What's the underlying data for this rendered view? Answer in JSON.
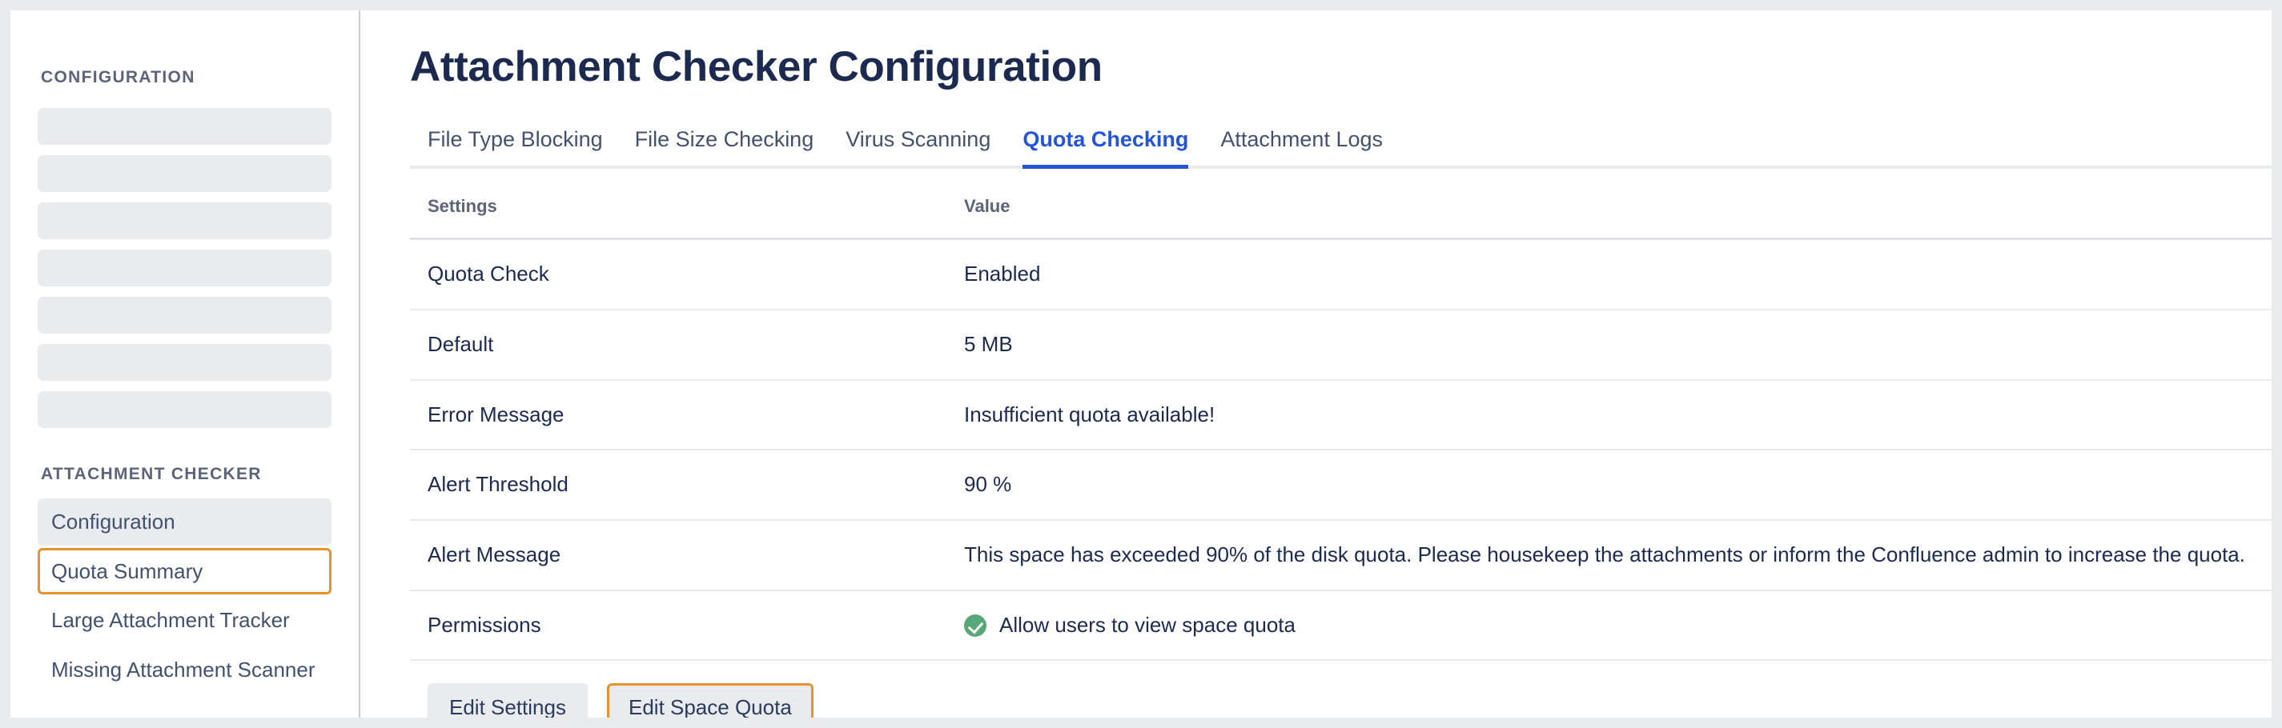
{
  "sidebar": {
    "config_heading": "CONFIGURATION",
    "skeleton_count": 7,
    "checker_heading": "ATTACHMENT CHECKER",
    "items": [
      {
        "label": "Configuration",
        "state": "active"
      },
      {
        "label": "Quota Summary",
        "state": "focused"
      },
      {
        "label": "Large Attachment Tracker",
        "state": "default"
      },
      {
        "label": "Missing Attachment Scanner",
        "state": "default"
      }
    ]
  },
  "main": {
    "page_title": "Attachment Checker Configuration",
    "tabs": [
      {
        "label": "File Type Blocking",
        "active": false
      },
      {
        "label": "File Size Checking",
        "active": false
      },
      {
        "label": "Virus Scanning",
        "active": false
      },
      {
        "label": "Quota Checking",
        "active": true
      },
      {
        "label": "Attachment Logs",
        "active": false
      }
    ],
    "table": {
      "headers": {
        "setting": "Settings",
        "value": "Value"
      },
      "rows": [
        {
          "setting": "Quota Check",
          "value": "Enabled"
        },
        {
          "setting": "Default",
          "value": "5 MB"
        },
        {
          "setting": "Error Message",
          "value": "Insufficient quota available!"
        },
        {
          "setting": "Alert Threshold",
          "value": "90 %"
        },
        {
          "setting": "Alert Message",
          "value": "This space has exceeded 90% of the disk quota. Please housekeep the attachments or inform the Confluence admin to increase the quota."
        },
        {
          "setting": "Permissions",
          "value": "Allow users to view space quota",
          "icon": "check-circle-icon"
        }
      ]
    },
    "buttons": [
      {
        "label": "Edit Settings",
        "focused": false
      },
      {
        "label": "Edit Space Quota",
        "focused": true
      }
    ]
  },
  "colors": {
    "accent_blue": "#2355d6",
    "focus_orange": "#e6922e",
    "success_green": "#57a877",
    "text_dark": "#1b2a4e",
    "muted": "#5b6478",
    "surface": "#e9ebef"
  }
}
